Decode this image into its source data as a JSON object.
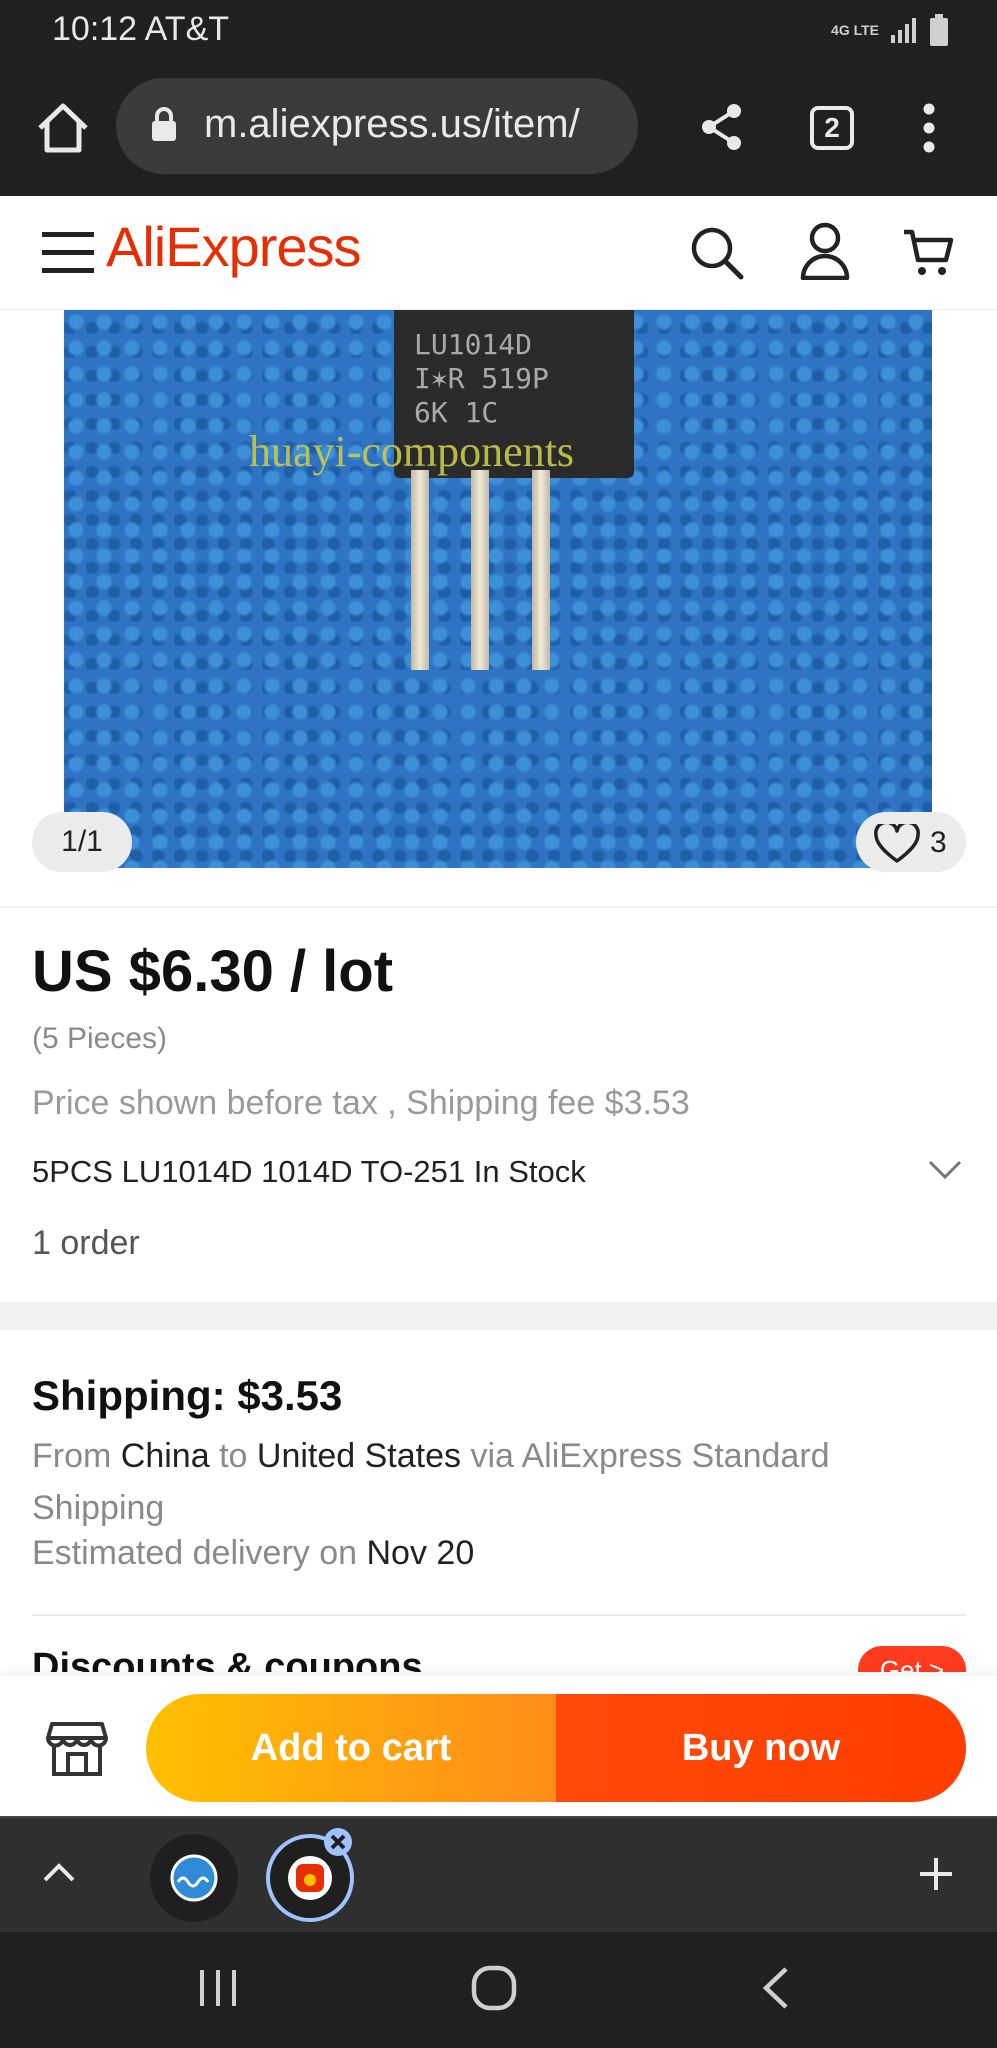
{
  "status_bar": {
    "time": "10:12 AT&T",
    "network": "4G LTE"
  },
  "browser": {
    "url": "m.aliexpress.us/item/",
    "tab_count": "2"
  },
  "header": {
    "logo": "AliExpress"
  },
  "gallery": {
    "chip_text": [
      "LU1014D",
      "I✶R 519P",
      "6K   1C"
    ],
    "watermark": "huayi-components",
    "pager": "1/1",
    "favorites": "3"
  },
  "product": {
    "price": "US $6.30 / lot",
    "pieces": "(5 Pieces)",
    "tax_note": "Price shown before tax , Shipping fee $3.53",
    "title": "5PCS LU1014D 1014D TO-251 In Stock",
    "orders": "1 order"
  },
  "shipping": {
    "title": "Shipping: $3.53",
    "from_label": "From",
    "from": "China",
    "to_label": "to",
    "to": "United States",
    "via": "via AliExpress Standard Shipping",
    "eta_label": "Estimated delivery on",
    "eta": "Nov 20"
  },
  "coupons": {
    "label": "Discounts & coupons",
    "get": "Get >"
  },
  "actions": {
    "add_to_cart": "Add to cart",
    "buy_now": "Buy now"
  },
  "colors": {
    "brand": "#e62e04",
    "cart_start": "#ffc000",
    "buy": "#ff3d00"
  },
  "icons": [
    "home-icon",
    "lock-icon",
    "share-icon",
    "more-icon",
    "menu-icon",
    "search-icon",
    "account-icon",
    "cart-icon",
    "heart-icon",
    "chevron-down-icon",
    "store-icon",
    "chevron-up-icon",
    "plus-icon",
    "recents-icon",
    "home-nav-icon",
    "back-icon"
  ]
}
